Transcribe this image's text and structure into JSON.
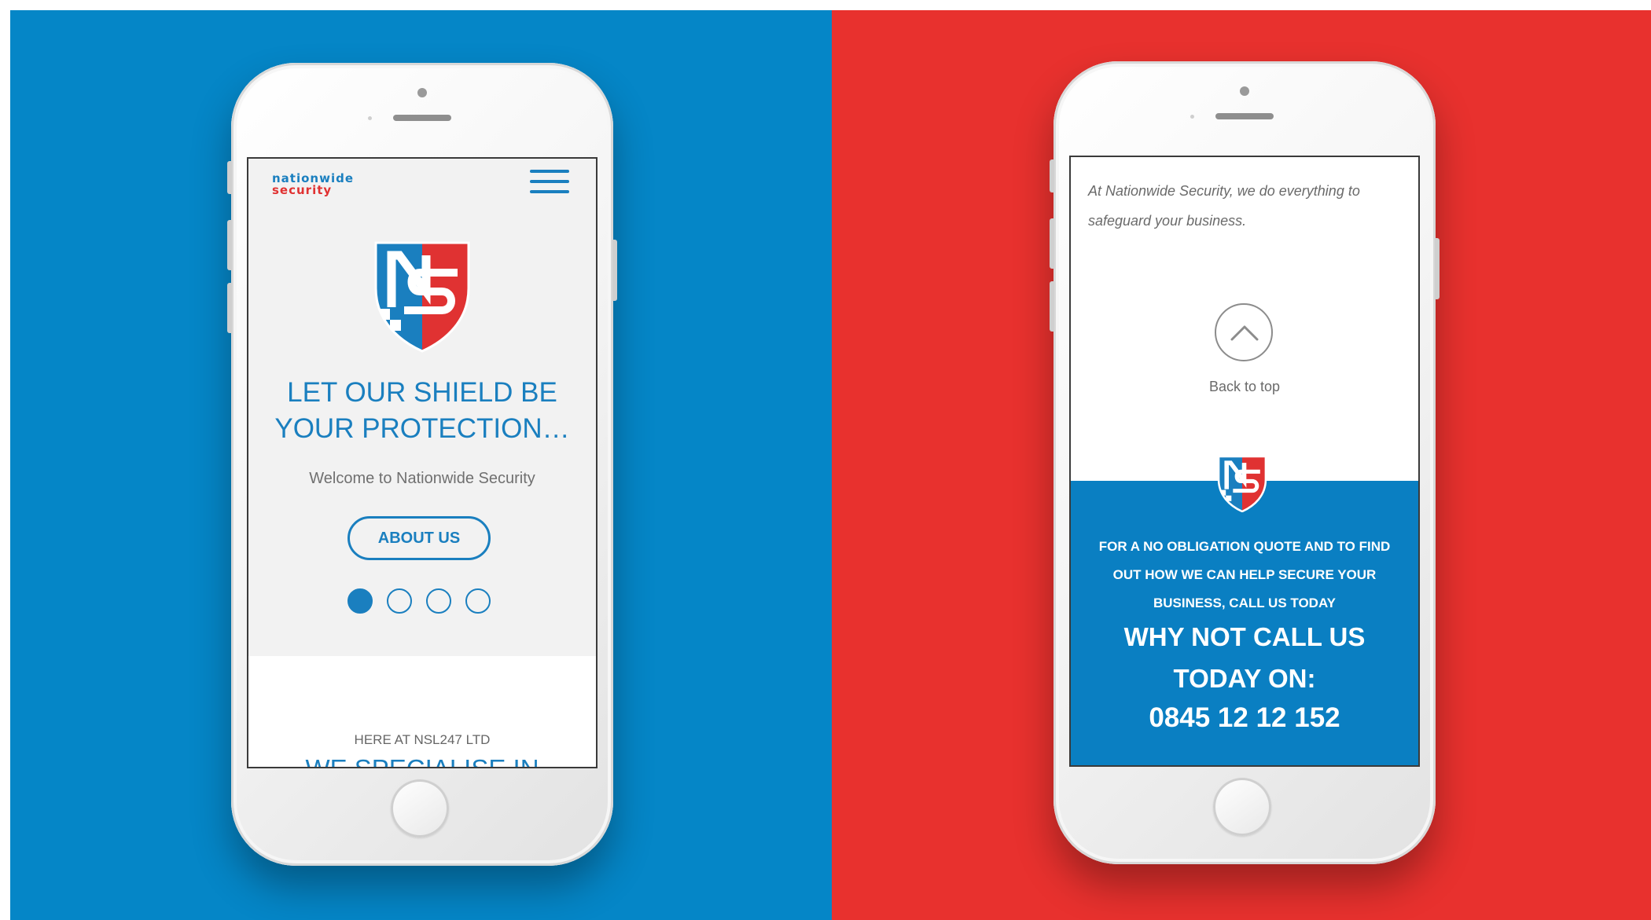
{
  "colors": {
    "left_background": "#0586c7",
    "right_background": "#e8312e",
    "brand_blue": "#1a7fbf",
    "brand_red": "#e03232",
    "cta_blue": "#0a7fc2"
  },
  "left_phone": {
    "brand_logo": {
      "line1": "Nationwide",
      "line2": "Security"
    },
    "menu_icon": "hamburger-icon",
    "shield_logo": "ns-shield-logo",
    "headline_line1": "LET OUR SHIELD BE",
    "headline_line2": "YOUR PROTECTION…",
    "welcome": "Welcome to Nationwide Security",
    "about_button": "ABOUT US",
    "carousel": {
      "total": 4,
      "active": 1
    },
    "here_at": "HERE AT NSL247 LTD",
    "we_specialise": "WE SPECIALISE IN"
  },
  "right_phone": {
    "intro": "At Nationwide Security, we do everything to safeguard your business.",
    "back_to_top_icon": "chevron-up-icon",
    "back_to_top_label": "Back to top",
    "shield_logo": "ns-shield-logo",
    "cta_text": "FOR A NO OBLIGATION QUOTE AND TO FIND OUT HOW WE CAN HELP SECURE YOUR BUSINESS, CALL US TODAY",
    "why_line1": "WHY NOT CALL US",
    "why_line2": "TODAY ON:",
    "phone_number": "0845 12 12 152"
  }
}
